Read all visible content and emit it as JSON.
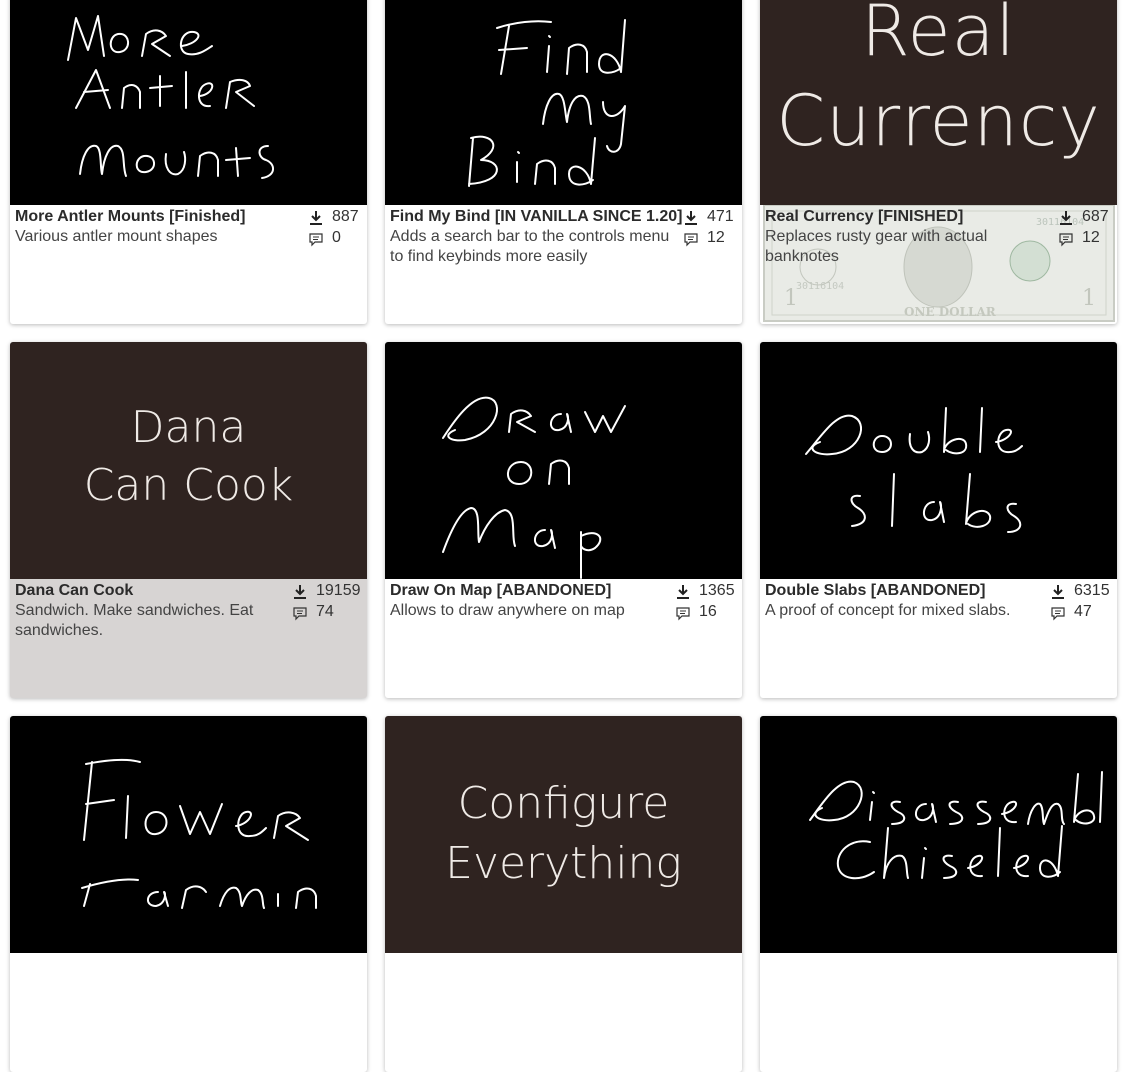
{
  "cards": [
    {
      "title": "More Antler Mounts [Finished]",
      "desc": "Various antler mount shapes",
      "downloads": "887",
      "comments": "0",
      "thumb_text": [
        "More",
        "Antler",
        "Mounts"
      ],
      "thumb_style": "handwritten"
    },
    {
      "title": "Find My Bind [IN VANILLA SINCE 1.20]",
      "desc": "Adds a search bar to the controls menu to find keybinds more easily",
      "downloads": "471",
      "comments": "12",
      "thumb_text": [
        "Find",
        "My",
        "Bind"
      ],
      "thumb_style": "handwritten"
    },
    {
      "title": "Real Currency [FINISHED]",
      "desc": "Replaces rusty gear with actual banknotes",
      "downloads": "687",
      "comments": "12",
      "thumb_text": [
        "Real",
        "Currency"
      ],
      "thumb_style": "typeset",
      "bill_text": [
        "30116104",
        "ONE DOLLAR",
        "1"
      ]
    },
    {
      "title": "Dana Can Cook",
      "desc": "Sandwich. Make sandwiches. Eat sandwiches.",
      "downloads": "19159",
      "comments": "74",
      "thumb_text": [
        "Dana",
        "Can Cook"
      ],
      "thumb_style": "typeset"
    },
    {
      "title": "Draw On Map [ABANDONED]",
      "desc": "Allows to draw anywhere on map",
      "downloads": "1365",
      "comments": "16",
      "thumb_text": [
        "Draw",
        "On",
        "Map"
      ],
      "thumb_style": "handwritten"
    },
    {
      "title": "Double Slabs [ABANDONED]",
      "desc": "A proof of concept for mixed slabs.",
      "downloads": "6315",
      "comments": "47",
      "thumb_text": [
        "Double",
        "slabs"
      ],
      "thumb_style": "handwritten"
    },
    {
      "thumb_text": [
        "Flower",
        "Farming"
      ],
      "thumb_style": "handwritten"
    },
    {
      "thumb_text": [
        "Configure",
        "Everything"
      ],
      "thumb_style": "typeset"
    },
    {
      "thumb_text": [
        "Disassemble",
        "Chiseled"
      ],
      "thumb_style": "handwritten"
    }
  ],
  "icons": {
    "download": "download-icon",
    "comment": "comment-icon"
  },
  "colors": {
    "thumb_black": "#000000",
    "thumb_brown": "#2f2320",
    "hover_card": "#d7d4d3"
  }
}
